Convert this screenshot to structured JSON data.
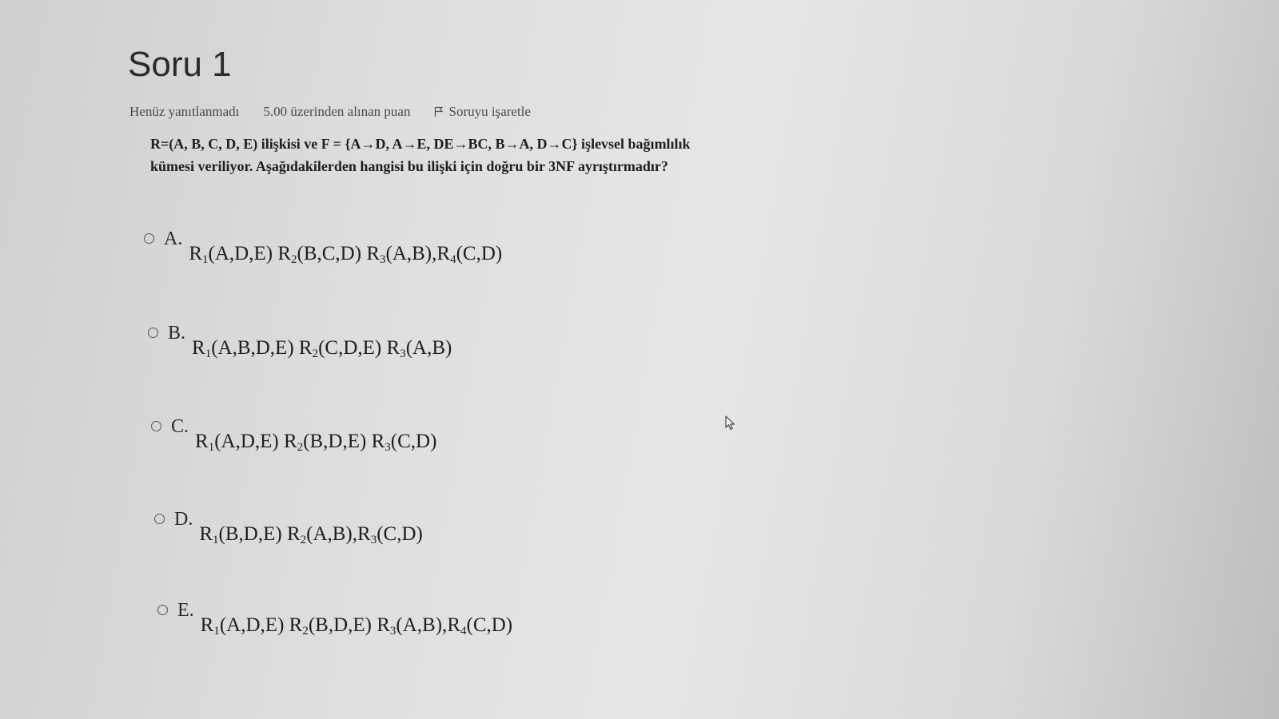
{
  "question": {
    "title": "Soru 1",
    "status": "Henüz yanıtlanmadı",
    "points": "5.00 üzerinden alınan puan",
    "flag_label": "Soruyu işaretle",
    "text_line1": "R=(A, B, C, D, E) ilişkisi ve F = {A→D, A→E, DE→BC, B→A, D→C} işlevsel bağımlılık",
    "text_line2": "kümesi veriliyor. Aşağıdakilerden hangisi bu ilişki için doğru bir 3NF ayrıştırmadır?"
  },
  "answers": [
    {
      "letter": "A.",
      "parts": [
        {
          "name": "R",
          "sub": "1",
          "attrs": "(A,D,E) "
        },
        {
          "name": "R",
          "sub": "2",
          "attrs": "(B,C,D) "
        },
        {
          "name": "R",
          "sub": "3",
          "attrs": "(A,B),"
        },
        {
          "name": "R",
          "sub": "4",
          "attrs": "(C,D)"
        }
      ]
    },
    {
      "letter": "B.",
      "parts": [
        {
          "name": "R",
          "sub": "1",
          "attrs": "(A,B,D,E) "
        },
        {
          "name": "R",
          "sub": "2",
          "attrs": "(C,D,E) "
        },
        {
          "name": "R",
          "sub": "3",
          "attrs": "(A,B)"
        }
      ]
    },
    {
      "letter": "C.",
      "parts": [
        {
          "name": "R",
          "sub": "1",
          "attrs": "(A,D,E) "
        },
        {
          "name": "R",
          "sub": "2",
          "attrs": "(B,D,E) "
        },
        {
          "name": "R",
          "sub": "3",
          "attrs": "(C,D)"
        }
      ]
    },
    {
      "letter": "D.",
      "parts": [
        {
          "name": "R",
          "sub": "1",
          "attrs": "(B,D,E) "
        },
        {
          "name": "R",
          "sub": "2",
          "attrs": "(A,B),"
        },
        {
          "name": "R",
          "sub": "3",
          "attrs": "(C,D)"
        }
      ]
    },
    {
      "letter": "E.",
      "parts": [
        {
          "name": "R",
          "sub": "1",
          "attrs": "(A,D,E) "
        },
        {
          "name": "R",
          "sub": "2",
          "attrs": "(B,D,E) "
        },
        {
          "name": "R",
          "sub": "3",
          "attrs": "(A,B),"
        },
        {
          "name": "R",
          "sub": "4",
          "attrs": "(C,D)"
        }
      ]
    }
  ],
  "icons": {
    "flag": "flag-icon",
    "radio": "radio-button-icon",
    "cursor": "mouse-pointer-icon"
  }
}
